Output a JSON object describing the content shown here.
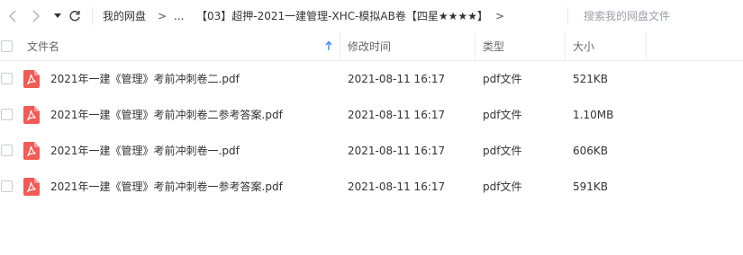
{
  "toolbar": {
    "back_icon": "chevron-left-icon",
    "forward_icon": "chevron-right-icon",
    "history_icon": "caret-down-icon",
    "refresh_icon": "refresh-icon",
    "breadcrumb": {
      "root": "我的网盘",
      "separator": ">",
      "ellipsis": "...",
      "current": "【03】超押-2021一建管理-XHC-模拟AB卷【四星★★★★】",
      "trailing_separator": ">"
    },
    "search_placeholder": "搜索我的网盘文件"
  },
  "columns": {
    "name": "文件名",
    "modified": "修改时间",
    "type": "类型",
    "size": "大小",
    "sort_icon": "sort-ascending-icon"
  },
  "files": [
    {
      "name": "2021年一建《管理》考前冲刺卷二.pdf",
      "modified": "2021-08-11 16:17",
      "type": "pdf文件",
      "size": "521KB",
      "icon": "pdf-file-icon"
    },
    {
      "name": "2021年一建《管理》考前冲刺卷二参考答案.pdf",
      "modified": "2021-08-11 16:17",
      "type": "pdf文件",
      "size": "1.10MB",
      "icon": "pdf-file-icon"
    },
    {
      "name": "2021年一建《管理》考前冲刺卷一.pdf",
      "modified": "2021-08-11 16:17",
      "type": "pdf文件",
      "size": "606KB",
      "icon": "pdf-file-icon"
    },
    {
      "name": "2021年一建《管理》考前冲刺卷一参考答案.pdf",
      "modified": "2021-08-11 16:17",
      "type": "pdf文件",
      "size": "591KB",
      "icon": "pdf-file-icon"
    }
  ],
  "colors": {
    "pdf_icon": "#f25a55",
    "sort_icon": "#3b8cff",
    "nav_icon": "#b8bcc4"
  }
}
